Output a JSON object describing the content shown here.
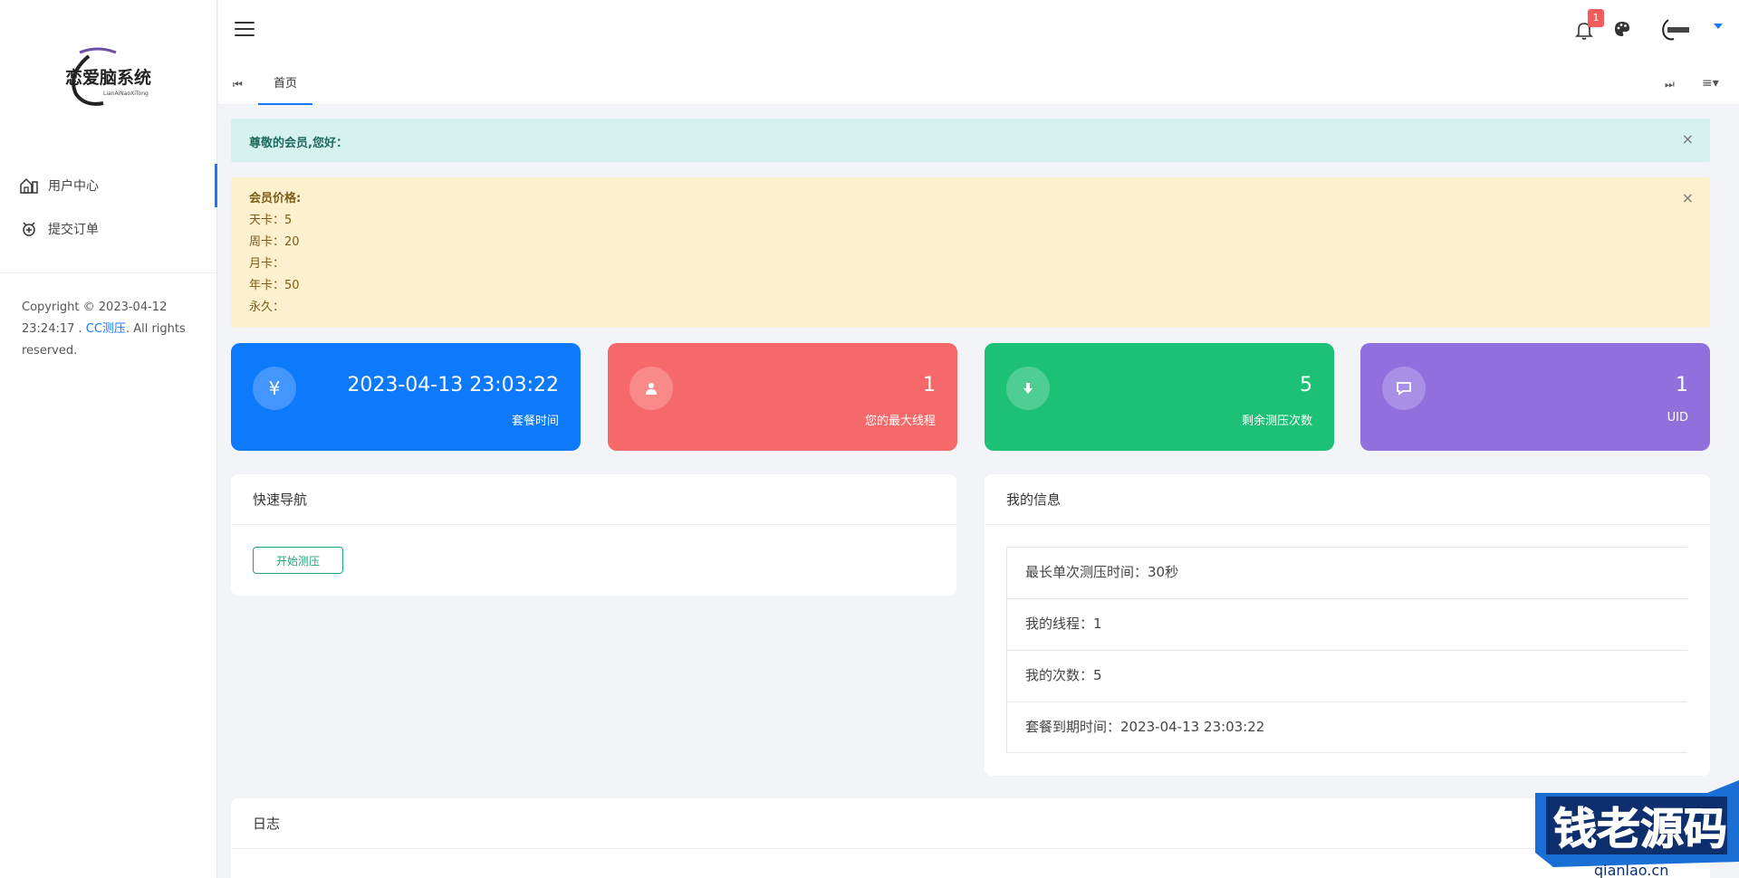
{
  "sidebar": {
    "logo_text": "恋爱脑系统",
    "logo_sub": "LianAiNaoXiTong",
    "items": [
      {
        "label": "用户中心",
        "icon": "home-icon"
      },
      {
        "label": "提交订单",
        "icon": "order-icon"
      }
    ],
    "copyright_prefix": "Copyright © 2023-04-12 23:24:17 . ",
    "copyright_link": "CC测压",
    "copyright_suffix": ". All rights reserved."
  },
  "header": {
    "notification_count": "1",
    "tab_label": "首页"
  },
  "alerts": {
    "greeting": "尊敬的会员,您好：",
    "price_title": "会员价格:",
    "price_lines": [
      "天卡：5",
      "周卡：20",
      "月卡：",
      "年卡：50",
      "永久："
    ],
    "close": "×"
  },
  "stats": [
    {
      "value": "2023-04-13 23:03:22",
      "label": "套餐时间",
      "icon": "yen-icon",
      "color": "#0d79fb"
    },
    {
      "value": "1",
      "label": "您的最大线程",
      "icon": "user-icon",
      "color": "#f6696a"
    },
    {
      "value": "5",
      "label": "剩余测压次数",
      "icon": "download-icon",
      "color": "#1dc175"
    },
    {
      "value": "1",
      "label": "UID",
      "icon": "comment-icon",
      "color": "#9170de"
    }
  ],
  "quick_nav": {
    "title": "快速导航",
    "button": "开始测压"
  },
  "my_info": {
    "title": "我的信息",
    "rows": [
      "最长单次测压时间：30秒",
      "我的线程：1",
      "我的次数：5",
      "套餐到期时间：2023-04-13 23:03:22"
    ]
  },
  "log": {
    "title": "日志"
  },
  "watermark": {
    "text": "钱老源码",
    "url": "qianlao.cn"
  }
}
